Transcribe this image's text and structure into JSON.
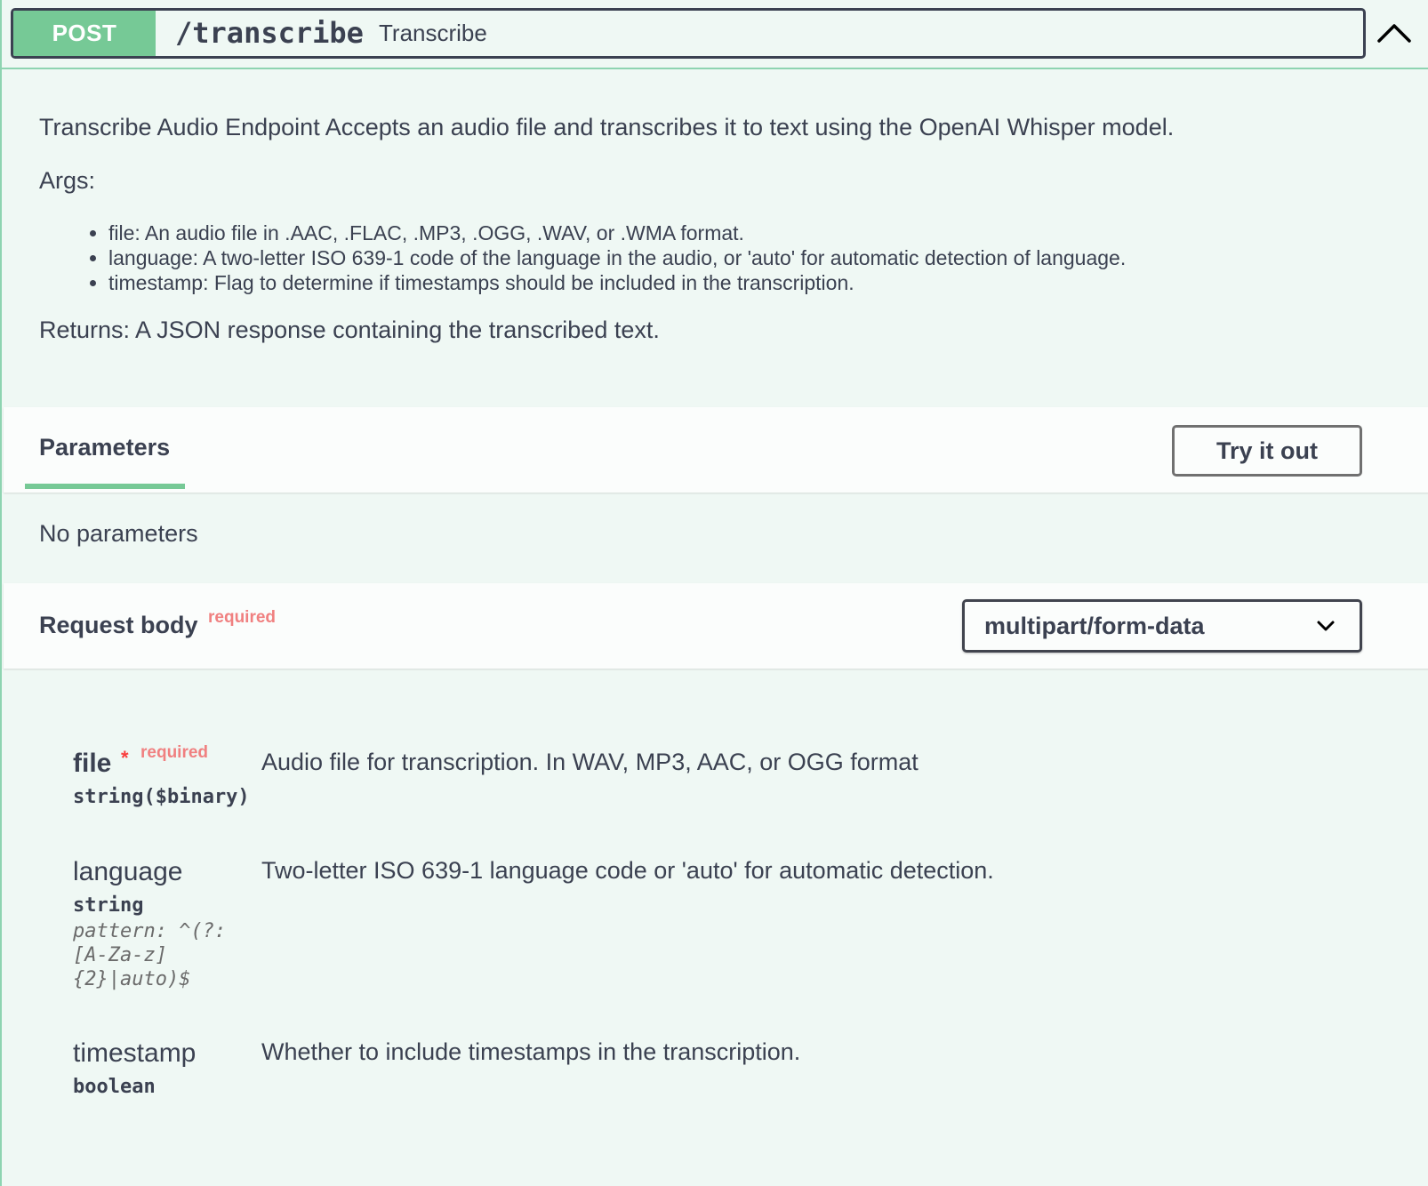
{
  "summary": {
    "method": "POST",
    "path": "/transcribe",
    "description": "Transcribe"
  },
  "description": {
    "main": "Transcribe Audio Endpoint Accepts an audio file and transcribes it to text using the OpenAI Whisper model.",
    "args_label": "Args:",
    "args": [
      "file: An audio file in .AAC, .FLAC, .MP3, .OGG, .WAV, or .WMA format.",
      "language: A two-letter ISO 639-1 code of the language in the audio, or 'auto' for automatic detection of language.",
      "timestamp: Flag to determine if timestamps should be included in the transcription."
    ],
    "returns": "Returns: A JSON response containing the transcribed text."
  },
  "parameters": {
    "title": "Parameters",
    "try_label": "Try it out",
    "empty_text": "No parameters"
  },
  "request_body": {
    "title": "Request body",
    "required_label": "required",
    "content_type": "multipart/form-data"
  },
  "properties": [
    {
      "name": "file",
      "required_star": "*",
      "required_label": "required",
      "type": "string($binary)",
      "pattern": "",
      "description": "Audio file for transcription. In WAV, MP3, AAC, or OGG format"
    },
    {
      "name": "language",
      "type": "string",
      "pattern": "pattern: ^(?:\n[A-Za-z]\n{2}|auto)$",
      "description": "Two-letter ISO 639-1 language code or 'auto' for automatic detection."
    },
    {
      "name": "timestamp",
      "type": "boolean",
      "description": "Whether to include timestamps in the transcription."
    }
  ],
  "icons": {
    "collapse": "chevron-up-icon",
    "select": "chevron-down-icon"
  },
  "colors": {
    "post_green": "#49cc90",
    "method_badge": "#76c996",
    "block_background": "#eff8f4",
    "required_red": "#f08080"
  }
}
